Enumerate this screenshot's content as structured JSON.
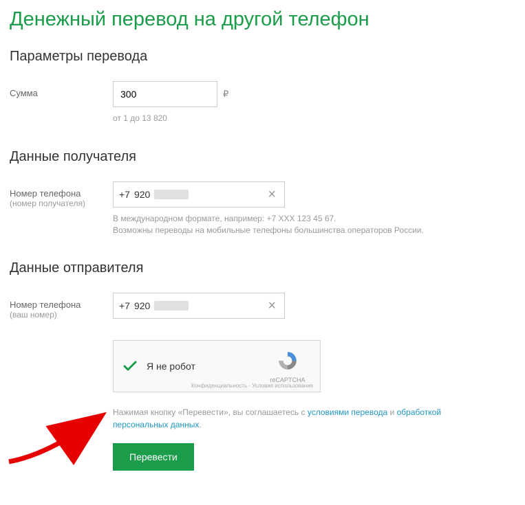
{
  "title": "Денежный перевод на другой телефон",
  "sections": {
    "params": {
      "heading": "Параметры перевода",
      "amount_label": "Сумма",
      "amount_value": "300",
      "currency": "₽",
      "amount_help": "от 1 до 13 820"
    },
    "recipient": {
      "heading": "Данные получателя",
      "phone_label": "Номер телефона",
      "phone_sublabel": "(номер получателя)",
      "phone_prefix": "+7",
      "phone_code": "920",
      "help1": "В международном формате, например: +7 XXX 123 45 67.",
      "help2": "Возможны переводы на мобильные телефоны большинства операторов России."
    },
    "sender": {
      "heading": "Данные отправителя",
      "phone_label": "Номер телефона",
      "phone_sublabel": "(ваш номер)",
      "phone_prefix": "+7",
      "phone_code": "920"
    }
  },
  "recaptcha": {
    "label": "Я не робот",
    "brand": "reCAPTCHA",
    "terms": "Конфиденциальность - Условия использования"
  },
  "consent": {
    "prefix": "Нажимая кнопку «Перевести», вы соглашаетесь с ",
    "link1": "условиями перевода",
    "mid": " и ",
    "link2": "обработкой персональных данных",
    "suffix": "."
  },
  "submit_label": "Перевести"
}
